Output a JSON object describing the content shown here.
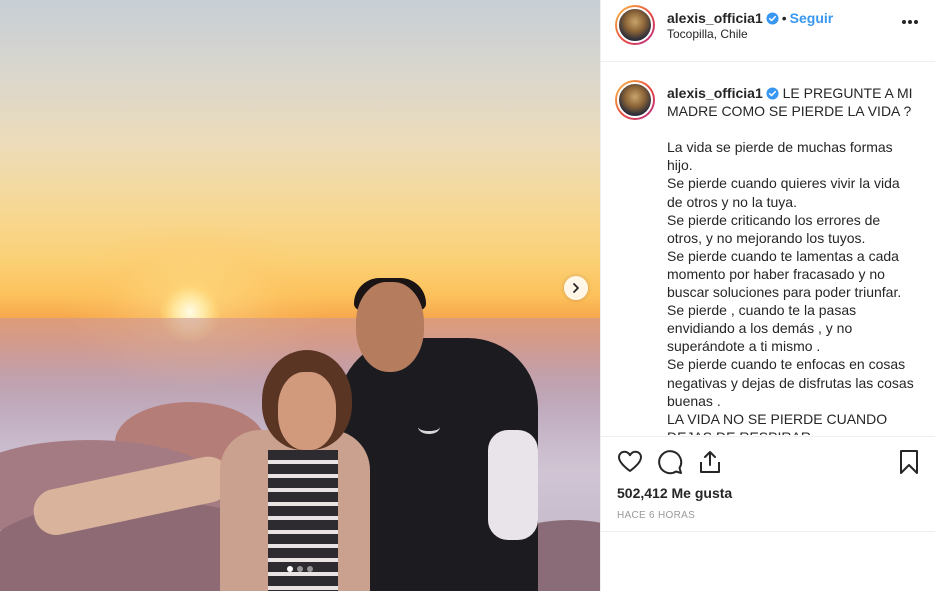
{
  "post": {
    "username": "alexis_officia1",
    "follow_label": "Seguir",
    "separator": "•",
    "location": "Tocopilla, Chile",
    "more_icon": "more-horizontal-icon",
    "caption": "LE PREGUNTE A MI MADRE COMO SE PIERDE LA VIDA ?\n\nLa vida se pierde de muchas formas hijo.\nSe pierde cuando quieres vivir la vida de otros y no la tuya.\nSe pierde criticando los errores de otros, y no mejorando los tuyos.\nSe pierde cuando te lamentas a cada momento por haber fracasado y no buscar soluciones para poder triunfar.\nSe pierde , cuando te la pasas envidiando a los demás , y no superándote a ti mismo .\nSe pierde cuando te enfocas en cosas negativas y dejas de disfrutas las cosas buenas .\nLA VIDA NO SE PIERDE CUANDO DEJAS DE RESPIRAR",
    "likes_count": "502,412",
    "likes_label": "Me gusta",
    "time_ago": "HACE 6 HORAS"
  },
  "carousel": {
    "slide_count": 3,
    "active_index": 0
  },
  "colors": {
    "link": "#3897f0",
    "verified": "#3897f0",
    "text": "#262626",
    "muted": "#999999"
  }
}
